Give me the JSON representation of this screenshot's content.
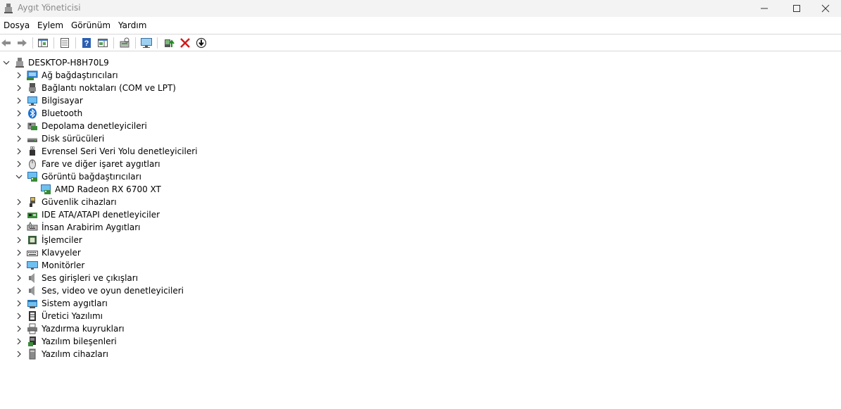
{
  "window": {
    "title": "Aygıt Yöneticisi"
  },
  "menu": [
    "Dosya",
    "Eylem",
    "Görünüm",
    "Yardım"
  ],
  "toolbar": {
    "buttons": [
      "back-icon",
      "forward-icon",
      "show-hide-console-tree-icon",
      "properties-icon",
      "help-icon",
      "action-pane-icon",
      "scan-hardware-icon",
      "monitor-display-icon",
      "update-driver-icon",
      "uninstall-device-icon",
      "disable-device-icon"
    ]
  },
  "tree": {
    "root": "DESKTOP-H8H70L9",
    "categories": [
      {
        "label": "Ağ bağdaştırıcıları",
        "icon": "network-adapter-icon",
        "expanded": false
      },
      {
        "label": "Bağlantı noktaları (COM ve LPT)",
        "icon": "port-icon",
        "expanded": false
      },
      {
        "label": "Bilgisayar",
        "icon": "computer-icon",
        "expanded": false
      },
      {
        "label": "Bluetooth",
        "icon": "bluetooth-icon",
        "expanded": false
      },
      {
        "label": "Depolama denetleyicileri",
        "icon": "storage-controller-icon",
        "expanded": false
      },
      {
        "label": "Disk sürücüleri",
        "icon": "disk-drive-icon",
        "expanded": false
      },
      {
        "label": "Evrensel Seri Veri Yolu denetleyicileri",
        "icon": "usb-icon",
        "expanded": false
      },
      {
        "label": "Fare ve diğer işaret aygıtları",
        "icon": "mouse-icon",
        "expanded": false
      },
      {
        "label": "Görüntü bağdaştırıcıları",
        "icon": "display-adapter-icon",
        "expanded": true,
        "children": [
          {
            "label": "AMD Radeon RX 6700 XT",
            "icon": "display-adapter-icon"
          }
        ]
      },
      {
        "label": "Güvenlik cihazları",
        "icon": "security-key-icon",
        "expanded": false
      },
      {
        "label": "IDE ATA/ATAPI denetleyiciler",
        "icon": "ide-controller-icon",
        "expanded": false
      },
      {
        "label": "İnsan Arabirim Aygıtları",
        "icon": "hid-icon",
        "expanded": false
      },
      {
        "label": "İşlemciler",
        "icon": "processor-icon",
        "expanded": false
      },
      {
        "label": "Klavyeler",
        "icon": "keyboard-icon",
        "expanded": false
      },
      {
        "label": "Monitörler",
        "icon": "monitor-icon",
        "expanded": false
      },
      {
        "label": "Ses girişleri ve çıkışları",
        "icon": "speaker-icon",
        "expanded": false
      },
      {
        "label": "Ses, video ve oyun denetleyicileri",
        "icon": "speaker-icon",
        "expanded": false
      },
      {
        "label": "Sistem aygıtları",
        "icon": "system-device-icon",
        "expanded": false
      },
      {
        "label": "Üretici Yazılımı",
        "icon": "firmware-icon",
        "expanded": false
      },
      {
        "label": "Yazdırma kuyrukları",
        "icon": "printer-icon",
        "expanded": false
      },
      {
        "label": "Yazılım bileşenleri",
        "icon": "software-component-icon",
        "expanded": false
      },
      {
        "label": "Yazılım cihazları",
        "icon": "software-device-icon",
        "expanded": false
      }
    ]
  }
}
